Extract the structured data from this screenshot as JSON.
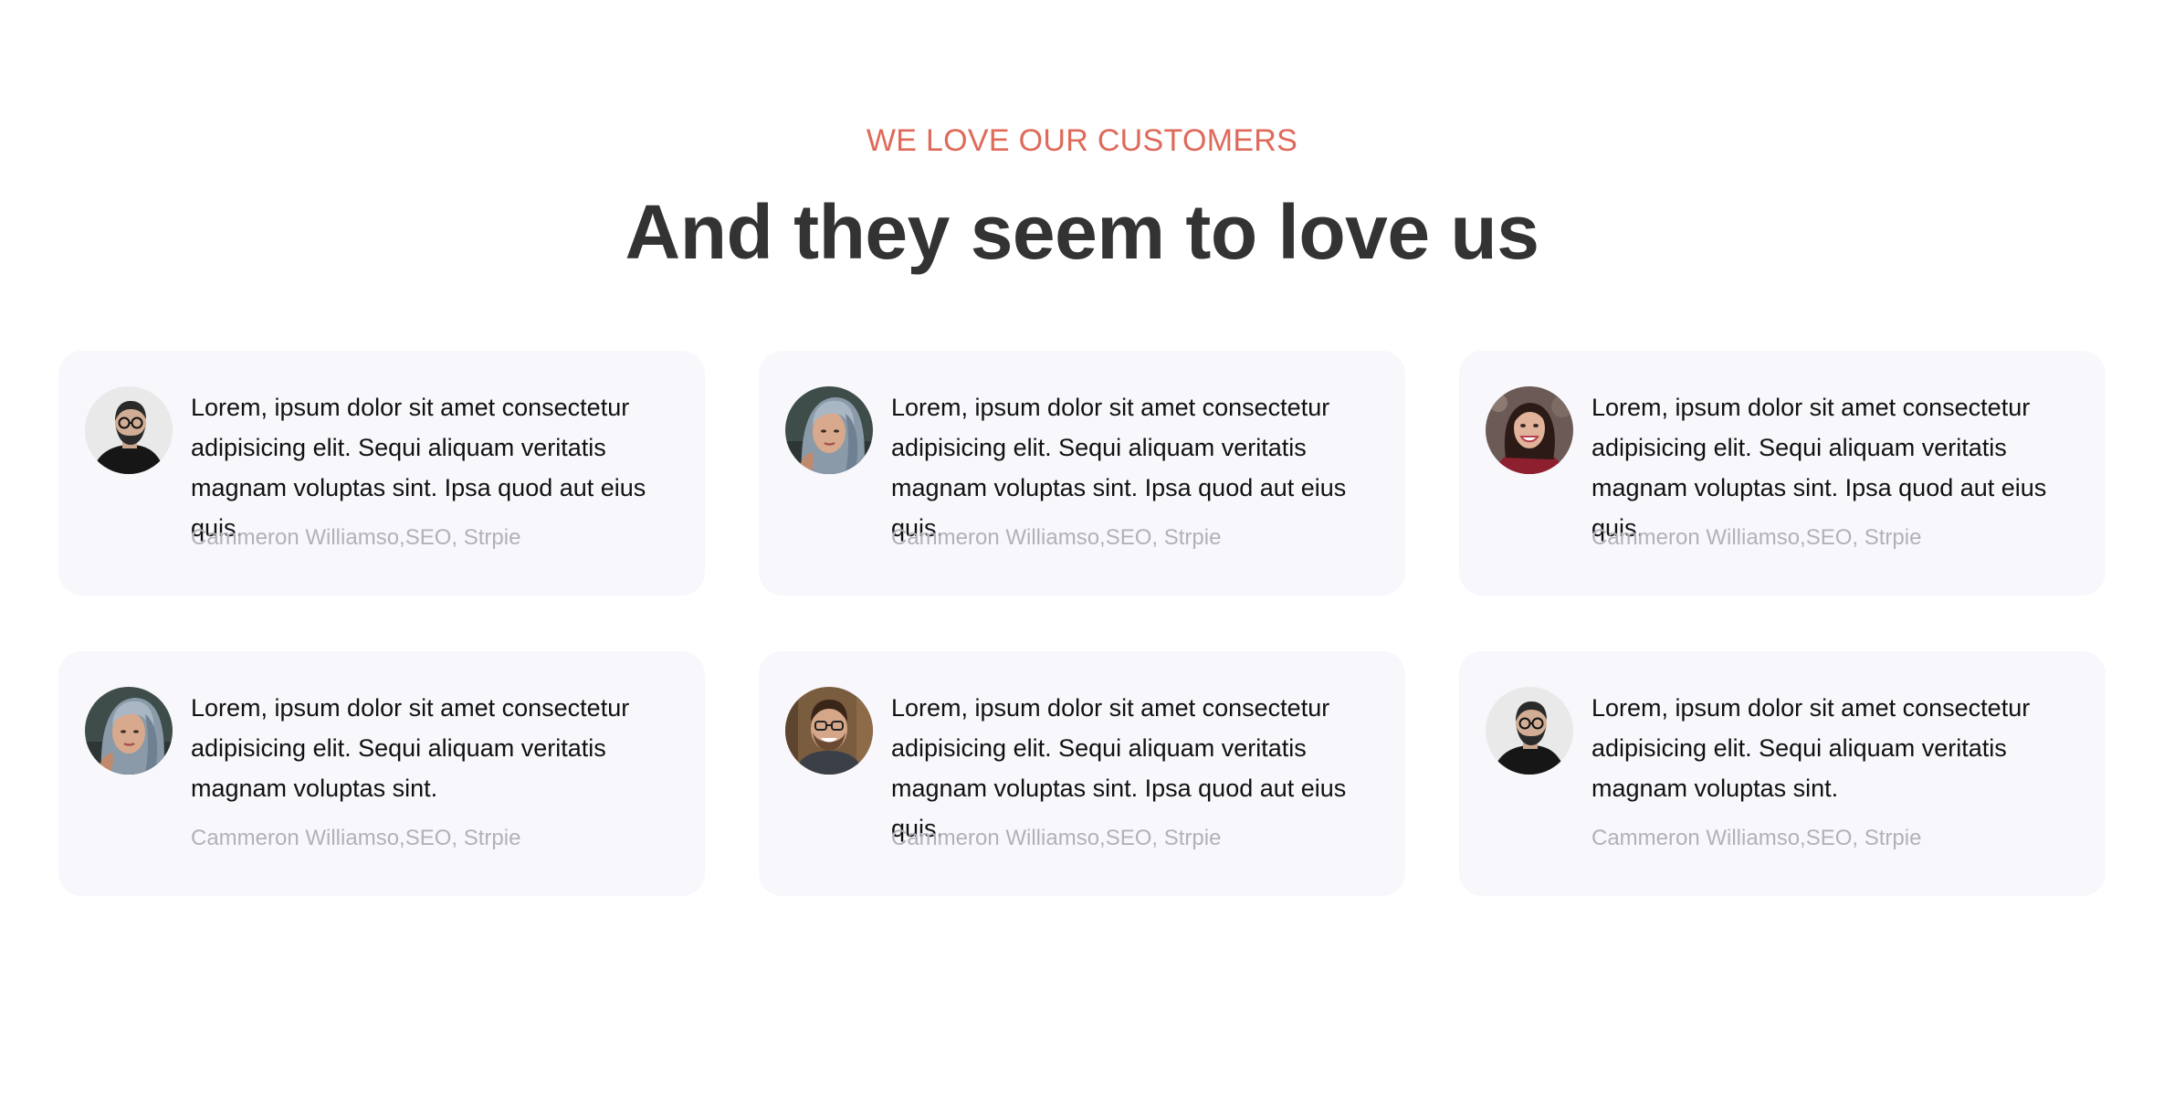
{
  "section": {
    "eyebrow": "WE LOVE OUR CUSTOMERS",
    "headline": "And they seem to love us"
  },
  "testimonials": [
    {
      "avatar_icon": "man-glasses-beard-avatar",
      "quote": "Lorem, ipsum dolor sit amet consectetur adipisicing elit. Sequi aliquam veritatis magnam voluptas sint. Ipsa quod aut eius quis.",
      "author": "Cammeron Williamso,SEO, Strpie"
    },
    {
      "avatar_icon": "woman-grey-hair-avatar",
      "quote": "Lorem, ipsum dolor sit amet consectetur adipisicing elit. Sequi aliquam veritatis magnam voluptas sint. Ipsa quod aut eius quis.",
      "author": "Cammeron Williamso,SEO, Strpie"
    },
    {
      "avatar_icon": "woman-smiling-avatar",
      "quote": "Lorem, ipsum dolor sit amet consectetur adipisicing elit. Sequi aliquam veritatis magnam voluptas sint. Ipsa quod aut eius quis.",
      "author": "Cammeron Williamso,SEO, Strpie"
    },
    {
      "avatar_icon": "woman-grey-hair-avatar",
      "quote": "Lorem, ipsum dolor sit amet consectetur adipisicing elit. Sequi aliquam veritatis magnam voluptas sint.",
      "author": "Cammeron Williamso,SEO, Strpie"
    },
    {
      "avatar_icon": "man-smiling-glasses-avatar",
      "quote": "Lorem, ipsum dolor sit amet consectetur adipisicing elit. Sequi aliquam veritatis magnam voluptas sint. Ipsa quod aut eius quis.",
      "author": "Cammeron Williamso,SEO, Strpie"
    },
    {
      "avatar_icon": "man-glasses-beard-avatar",
      "quote": "Lorem, ipsum dolor sit amet consectetur adipisicing elit. Sequi aliquam veritatis magnam voluptas sint.",
      "author": "Cammeron Williamso,SEO, Strpie"
    }
  ],
  "colors": {
    "accent": "#df6a5a",
    "headline": "#333333",
    "card_background": "#f7f7fc",
    "author_text": "#b1b1b8"
  }
}
